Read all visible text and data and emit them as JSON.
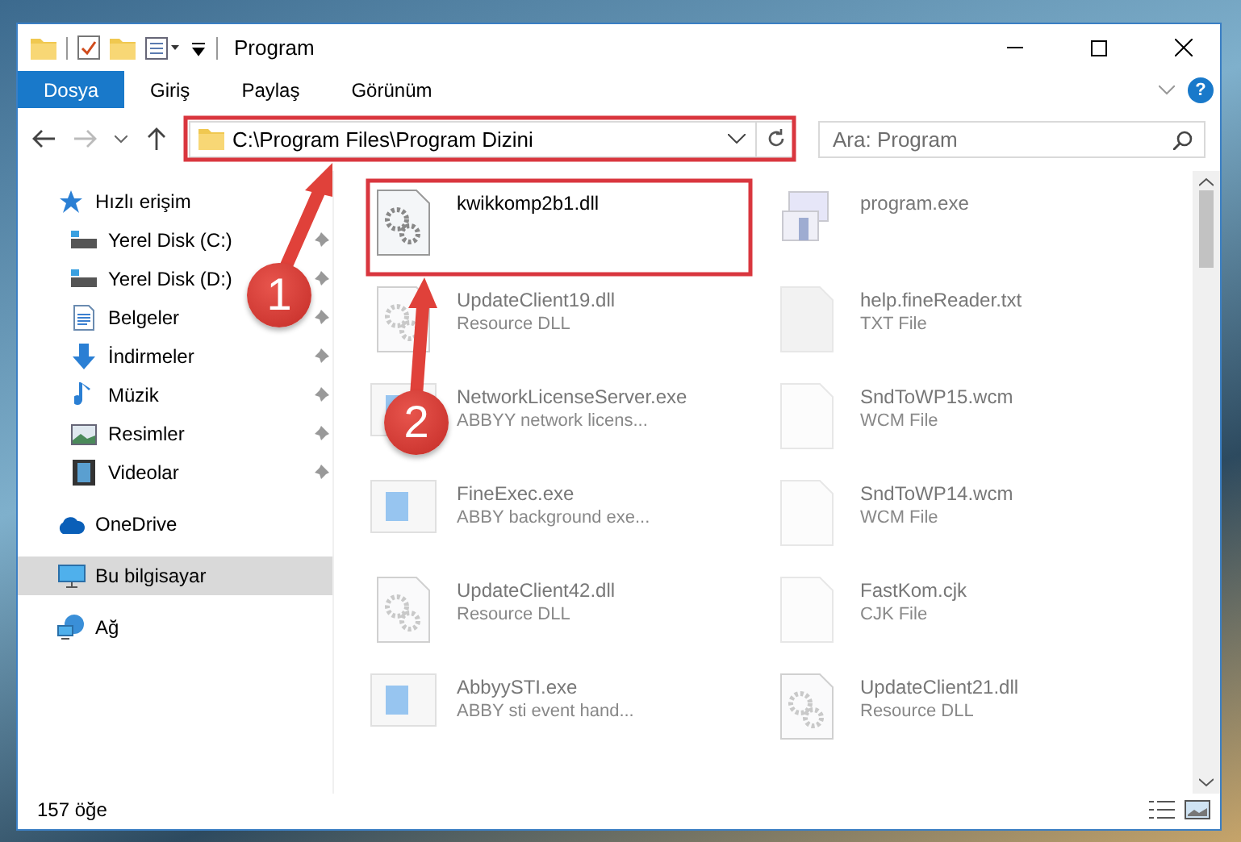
{
  "window": {
    "title": "Program"
  },
  "ribbon_tabs": [
    {
      "label": "Dosya",
      "selected": true
    },
    {
      "label": "Giriş",
      "selected": false
    },
    {
      "label": "Paylaş",
      "selected": false
    },
    {
      "label": "Görünüm",
      "selected": false
    }
  ],
  "address_bar": {
    "path": "C:\\Program Files\\Program Dizini"
  },
  "help": {
    "label": "?"
  },
  "search": {
    "placeholder": "Ara: Program"
  },
  "nav": [
    {
      "label": "Hızlı erişim",
      "kind": "star",
      "selected": false,
      "children": [
        {
          "label": "Yerel Disk (C:)",
          "kind": "drive",
          "pinned": true,
          "selected": false
        },
        {
          "label": "Yerel Disk (D:)",
          "kind": "drive",
          "pinned": true,
          "selected": false
        },
        {
          "label": "Belgeler",
          "kind": "document",
          "pinned": true,
          "selected": false
        },
        {
          "label": "İndirmeler",
          "kind": "download",
          "pinned": true,
          "selected": false
        },
        {
          "label": "Müzik",
          "kind": "music",
          "pinned": true,
          "selected": false
        },
        {
          "label": "Resimler",
          "kind": "picture",
          "pinned": true,
          "selected": false
        },
        {
          "label": "Videolar",
          "kind": "video",
          "pinned": true,
          "selected": false
        }
      ]
    },
    {
      "label": "OneDrive",
      "kind": "cloud",
      "selected": false
    },
    {
      "label": "Bu bilgisayar",
      "kind": "computer",
      "selected": true
    },
    {
      "label": "Ağ",
      "kind": "network",
      "selected": false
    }
  ],
  "files": [
    {
      "name": "kwikkomp2b1.dll",
      "kind": "dll",
      "dimmed": false
    },
    {
      "name": "program.exe",
      "kind": "program",
      "dimmed": true
    },
    {
      "name": "UpdateClient19.dll",
      "type": "Resource DLL",
      "kind": "dll",
      "dimmed": true
    },
    {
      "name": "help.fineReader.txt",
      "type": "TXT File",
      "kind": "txt",
      "dimmed": true
    },
    {
      "name": "NetworkLicenseServer.exe",
      "type": "ABBYY network licens...",
      "kind": "exe",
      "dimmed": true
    },
    {
      "name": "SndToWP15.wcm",
      "type": "WCM File",
      "kind": "file",
      "dimmed": true
    },
    {
      "name": "FineExec.exe",
      "type": "ABBY background exe...",
      "kind": "exe",
      "dimmed": true
    },
    {
      "name": "SndToWP14.wcm",
      "type": "WCM File",
      "kind": "file",
      "dimmed": true
    },
    {
      "name": "UpdateClient42.dll",
      "type": "Resource DLL",
      "kind": "dll",
      "dimmed": true
    },
    {
      "name": "FastKom.cjk",
      "type": "CJK File",
      "kind": "file",
      "dimmed": true
    },
    {
      "name": "AbbyySTI.exe",
      "type": "ABBY sti event hand...",
      "kind": "exe",
      "dimmed": true
    },
    {
      "name": "UpdateClient21.dll",
      "type": "Resource DLL",
      "kind": "dll",
      "dimmed": true
    }
  ],
  "status_bar": {
    "count": "157 öğe"
  },
  "annotations": [
    {
      "label": "1"
    },
    {
      "label": "2"
    }
  ]
}
